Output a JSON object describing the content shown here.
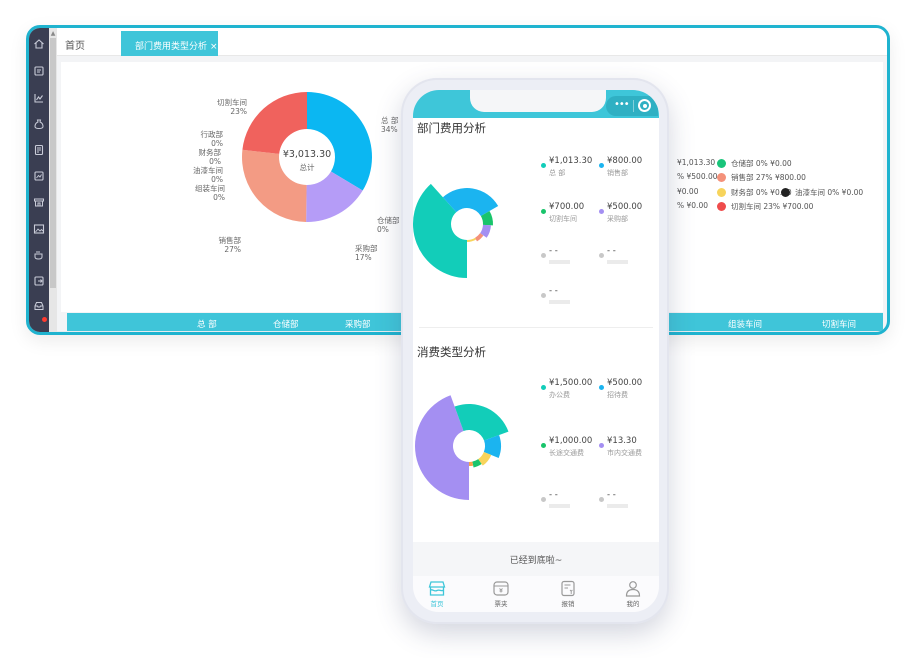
{
  "desktop": {
    "tabs": {
      "home": "首页",
      "active": "部门费用类型分析",
      "close": "×"
    },
    "sidebar_icons": [
      "home-icon",
      "bill-icon",
      "chart-icon",
      "money-bag-icon",
      "document-icon",
      "report-icon",
      "shop-icon",
      "image-icon",
      "coffee-icon",
      "export-icon",
      "inbox-icon"
    ],
    "donut": {
      "center_value": "¥3,013.30",
      "center_label": "总计",
      "labels": [
        {
          "name": "切割车间",
          "pct": "23%"
        },
        {
          "name": "总 部",
          "pct": "34%"
        },
        {
          "name": "行政部",
          "pct": "0%"
        },
        {
          "name": "财务部",
          "pct": "0%"
        },
        {
          "name": "油漆车间",
          "pct": "0%"
        },
        {
          "name": "组装车间",
          "pct": "0%"
        },
        {
          "name": "仓储部",
          "pct": "0%"
        },
        {
          "name": "采购部",
          "pct": "17%"
        },
        {
          "name": "销售部",
          "pct": "27%"
        }
      ]
    },
    "legend": [
      {
        "text": "¥1,013.30",
        "color": ""
      },
      {
        "text": "仓储部 0%  ¥0.00",
        "color": "#19c47a"
      },
      {
        "text": "% ¥500.00",
        "color": ""
      },
      {
        "text": "销售部 27%  ¥800.00",
        "color": "#f4917a"
      },
      {
        "text": "¥0.00",
        "color": ""
      },
      {
        "text": "财务部 0%  ¥0.00",
        "color": "#f7d45c"
      },
      {
        "text": "油漆车间 0%  ¥0.00",
        "color": "#222222"
      },
      {
        "text": "% ¥0.00",
        "color": ""
      },
      {
        "text": "切割车间 23%  ¥700.00",
        "color": "#ef4c4c"
      }
    ],
    "table_headers": [
      "总 部",
      "仓储部",
      "采购部",
      "组装车间",
      "切割车间"
    ]
  },
  "phone": {
    "section1": {
      "title": "部门费用分析",
      "items": [
        {
          "value": "¥1,013.30",
          "label": "总 部",
          "color": "#12cdb9"
        },
        {
          "value": "¥800.00",
          "label": "销售部",
          "color": "#1bb4f0"
        },
        {
          "value": "¥700.00",
          "label": "切割车间",
          "color": "#19c46b"
        },
        {
          "value": "¥500.00",
          "label": "采购部",
          "color": "#a48ff2"
        },
        {
          "value": "- -",
          "label": "",
          "color": "#c8c8c8"
        },
        {
          "value": "- -",
          "label": "",
          "color": "#c8c8c8"
        },
        {
          "value": "- -",
          "label": "",
          "color": "#c8c8c8"
        }
      ]
    },
    "section2": {
      "title": "消费类型分析",
      "items": [
        {
          "value": "¥1,500.00",
          "label": "办公费",
          "color": "#12cdb9"
        },
        {
          "value": "¥500.00",
          "label": "招待费",
          "color": "#1bb4f0"
        },
        {
          "value": "¥1,000.00",
          "label": "长途交通费",
          "color": "#19c46b"
        },
        {
          "value": "¥13.30",
          "label": "市内交通费",
          "color": "#a48ff2"
        },
        {
          "value": "- -",
          "label": "",
          "color": "#c8c8c8"
        },
        {
          "value": "- -",
          "label": "",
          "color": "#c8c8c8"
        }
      ]
    },
    "end_text": "已经到底啦~",
    "tabbar": [
      {
        "label": "首页",
        "icon": "shop-icon",
        "active": true
      },
      {
        "label": "票夹",
        "icon": "ticket-box-icon",
        "active": false
      },
      {
        "label": "报销",
        "icon": "reimburse-icon",
        "active": false
      },
      {
        "label": "我的",
        "icon": "user-icon",
        "active": false
      }
    ]
  },
  "colors": {
    "accent": "#3fc5d9",
    "frame": "#1fb3cf",
    "sidebar": "#3a3e52",
    "donut_total": "#0bb7f2",
    "donut_purchase": "#b59cf7",
    "donut_sales": "#f39b84",
    "donut_cutting": "#f0625d"
  }
}
